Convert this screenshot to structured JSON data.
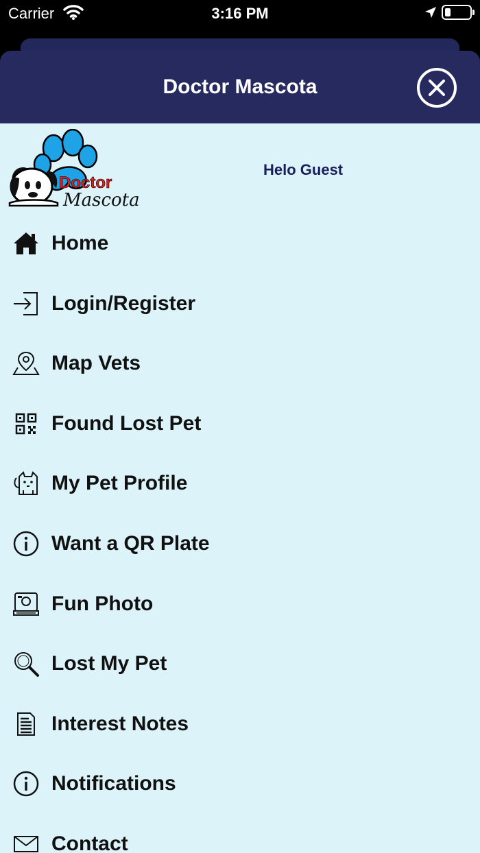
{
  "status_bar": {
    "carrier": "Carrier",
    "time": "3:16 PM"
  },
  "header": {
    "title": "Doctor Mascota",
    "close_icon": "close-circle-icon"
  },
  "profile": {
    "logo_text_top": "Doctor",
    "logo_text_bottom": "Mascota",
    "greeting": "Helo Guest"
  },
  "menu": {
    "items": [
      {
        "label": "Home",
        "icon": "home-icon"
      },
      {
        "label": "Login/Register",
        "icon": "login-icon"
      },
      {
        "label": "Map Vets",
        "icon": "map-pin-icon"
      },
      {
        "label": "Found Lost Pet",
        "icon": "qr-code-icon"
      },
      {
        "label": "My Pet Profile",
        "icon": "pet-profile-icon"
      },
      {
        "label": "Want a QR Plate",
        "icon": "info-icon"
      },
      {
        "label": "Fun Photo",
        "icon": "camera-icon"
      },
      {
        "label": "Lost My Pet",
        "icon": "search-icon"
      },
      {
        "label": "Interest Notes",
        "icon": "document-icon"
      },
      {
        "label": "Notifications",
        "icon": "info-icon"
      },
      {
        "label": "Contact",
        "icon": "mail-icon"
      }
    ]
  },
  "colors": {
    "header_bg": "#262a5e",
    "panel_bg": "#dcf4f9",
    "greeting_text": "#1a1f5c",
    "logo_red": "#e02020",
    "logo_blue": "#1ea4e6"
  }
}
